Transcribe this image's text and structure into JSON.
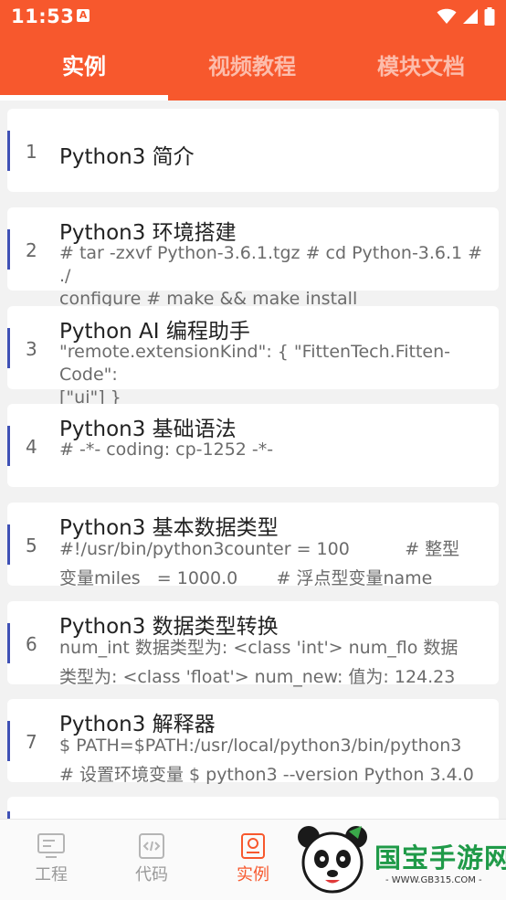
{
  "status": {
    "time": "11:53",
    "app_badge": "A"
  },
  "tabs": [
    {
      "label": "实例",
      "active": true
    },
    {
      "label": "视频教程",
      "active": false
    },
    {
      "label": "模块文档",
      "active": false
    }
  ],
  "items": [
    {
      "num": "1",
      "title": "Python3 简介",
      "desc": ""
    },
    {
      "num": "2",
      "title": "Python3 环境搭建",
      "desc": "# tar -zxvf Python-3.6.1.tgz # cd Python-3.6.1 # ./\nconfigure # make && make install"
    },
    {
      "num": "3",
      "title": "Python AI 编程助手",
      "desc": "\"remote.extensionKind\": { \"FittenTech.Fitten-Code\":\n[\"ui\"] }"
    },
    {
      "num": "4",
      "title": "Python3 基础语法",
      "desc": "# -*- coding: cp-1252 -*-"
    },
    {
      "num": "5",
      "title": "Python3 基本数据类型",
      "desc": "#!/usr/bin/python3counter = 100          # 整型\n变量miles   = 1000.0       # 浮点型变量name"
    },
    {
      "num": "6",
      "title": "Python3 数据类型转换",
      "desc": "num_int 数据类型为: <class 'int'> num_flo 数据\n类型为: <class 'float'> num_new: 值为: 124.23"
    },
    {
      "num": "7",
      "title": "Python3 解释器",
      "desc": "$ PATH=$PATH:/usr/local/python3/bin/python3\n# 设置环境变量 $ python3 --version Python 3.4.0"
    }
  ],
  "bottom_nav": [
    {
      "label": "工程",
      "icon": "project-icon",
      "active": false
    },
    {
      "label": "代码",
      "icon": "code-icon",
      "active": false
    },
    {
      "label": "实例",
      "icon": "example-icon",
      "active": true
    }
  ],
  "watermark": {
    "brand": "国宝手游网",
    "url": "- WWW.GB315.COM -"
  },
  "colors": {
    "accent": "#f7582d",
    "item_bar": "#3f51b5"
  }
}
